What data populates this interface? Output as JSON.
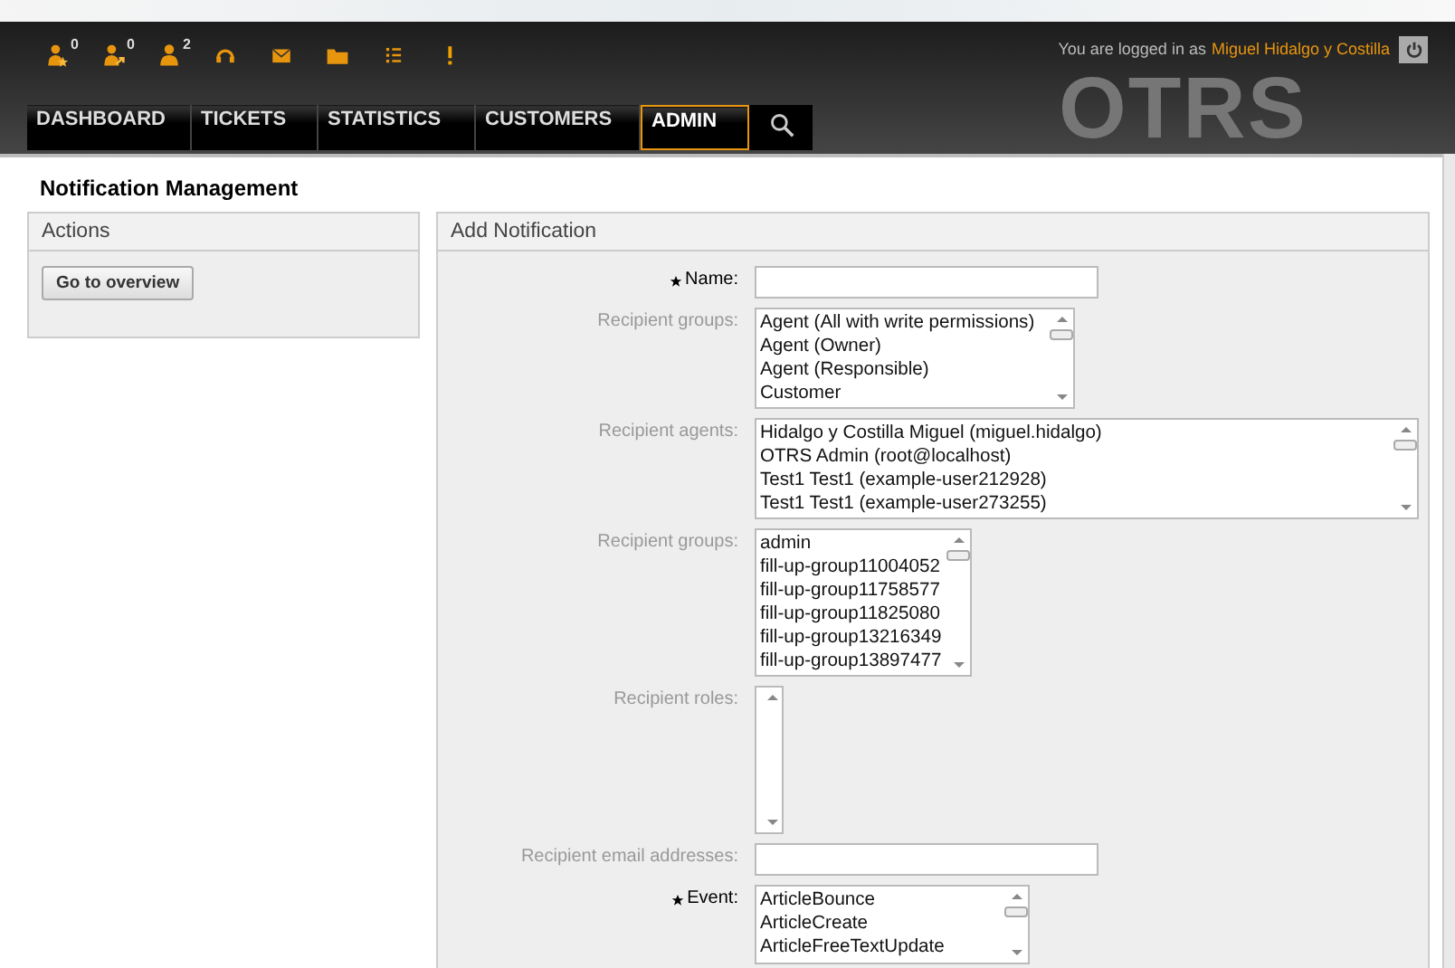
{
  "header": {
    "toolbar": [
      {
        "kind": "person-star",
        "count": "0"
      },
      {
        "kind": "person-arrow",
        "count": "0"
      },
      {
        "kind": "person",
        "count": "2"
      },
      {
        "kind": "headset"
      },
      {
        "kind": "envelope"
      },
      {
        "kind": "folder"
      },
      {
        "kind": "list"
      },
      {
        "kind": "alert"
      }
    ],
    "logo": "OTRS",
    "login_text": "You are logged in as",
    "user": "Miguel Hidalgo y Costilla",
    "nav": [
      {
        "label": "DASHBOARD",
        "selected": false
      },
      {
        "label": "TICKETS",
        "selected": false
      },
      {
        "label": "STATISTICS",
        "selected": false
      },
      {
        "label": "CUSTOMERS",
        "selected": false
      },
      {
        "label": "ADMIN",
        "selected": true
      }
    ]
  },
  "page_title": "Notification Management",
  "actions": {
    "title": "Actions",
    "button": "Go to overview"
  },
  "form": {
    "title": "Add Notification",
    "fields": [
      {
        "kind": "text",
        "label": "Name:",
        "required": true
      },
      {
        "kind": "list",
        "label": "Recipient groups:",
        "required": false,
        "options": [
          "Agent (All with write permissions)",
          "Agent (Owner)",
          "Agent (Responsible)",
          "Customer"
        ]
      },
      {
        "kind": "list",
        "label": "Recipient agents:",
        "required": false,
        "options": [
          "Hidalgo y Costilla Miguel (miguel.hidalgo)",
          "OTRS Admin (root@localhost)",
          "Test1 Test1 (example-user212928)",
          "Test1 Test1 (example-user273255)"
        ]
      },
      {
        "kind": "list",
        "label": "Recipient groups:",
        "required": false,
        "options": [
          "admin",
          "fill-up-group11004052",
          "fill-up-group11758577",
          "fill-up-group11825080",
          "fill-up-group13216349",
          "fill-up-group13897477"
        ]
      },
      {
        "kind": "list",
        "label": "Recipient roles:",
        "required": false
      },
      {
        "kind": "text",
        "label": "Recipient email addresses:",
        "required": false
      },
      {
        "kind": "list",
        "label": "Event:",
        "required": true,
        "options": [
          "ArticleBounce",
          "ArticleCreate",
          "ArticleFreeTextUpdate"
        ]
      }
    ]
  }
}
